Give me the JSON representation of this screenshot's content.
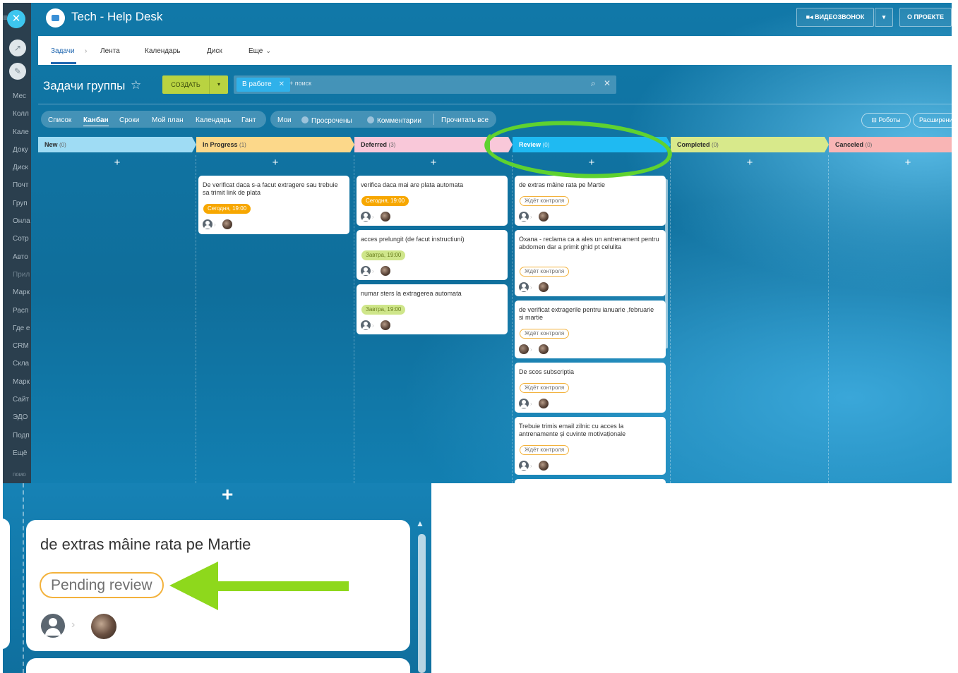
{
  "window": {
    "title": "Tech - Help Desk",
    "video_call": "ВИДЕОЗВОНОК",
    "about": "О ПРОЕКТЕ"
  },
  "leftbar": {
    "items": [
      "Мес",
      "Колл",
      "Кале",
      "Доку",
      "Диск",
      "Почт",
      "Груп",
      "Онла",
      "Сотр",
      "Авто",
      "Прил",
      "Марк",
      "Расп",
      "Где е",
      "CRM",
      "Скла",
      "Марк",
      "Сайт",
      "ЭДО",
      "Подп",
      "Ещё"
    ],
    "bottom": "помо"
  },
  "tabs": [
    "Задачи",
    "Лента",
    "Календарь",
    "Диск",
    "Еще"
  ],
  "page": {
    "title": "Задачи группы",
    "create": "СОЗДАТЬ",
    "filter_chip": "В работе",
    "search_placeholder": "+ поиск"
  },
  "views": {
    "list": "Список",
    "kanban": "Канбан",
    "deadlines": "Сроки",
    "myplan": "Мой план",
    "calendar": "Календарь",
    "gantt": "Гант",
    "mine": "Мои",
    "overdue": "Просрочены",
    "comments": "Комментарии",
    "readall": "Прочитать все",
    "robots": "Роботы",
    "extensions": "Расширени"
  },
  "columns": [
    {
      "name": "New",
      "count": "(0)",
      "color": "#9fdcf4"
    },
    {
      "name": "In Progress",
      "count": "(1)",
      "color": "#fcd88a"
    },
    {
      "name": "Deferred",
      "count": "(3)",
      "color": "#f9c8d9"
    },
    {
      "name": "Review",
      "count": "(0)",
      "color": "#1fbaf2"
    },
    {
      "name": "Completed",
      "count": "(0)",
      "color": "#d8e98b"
    },
    {
      "name": "Canceled",
      "count": "(0)",
      "color": "#f9b5b5"
    }
  ],
  "cards": {
    "inprogress": [
      {
        "title": "De verificat daca s-a facut extragere sau trebuie sa trimit link de plata",
        "badge": "Сегодня, 19:00"
      }
    ],
    "deferred": [
      {
        "title": "verifica daca mai are plata automata",
        "badge": "Сегодня, 19:00"
      },
      {
        "title": "acces prelungit (de facut instructiuni)",
        "badge": "Завтра, 19:00"
      },
      {
        "title": "numar sters la extragerea automata",
        "badge": "Завтра, 19:00"
      }
    ],
    "review": [
      {
        "title": "de extras mâine rata pe Martie",
        "badge": "Ждёт контроля"
      },
      {
        "title": "Oxana - reclama ca a ales un antrenament pentru abdomen dar a primit ghid pt celulita",
        "badge": "Ждёт контроля"
      },
      {
        "title": "de verificat extragerile pentru ianuarie ,februarie si martie",
        "badge": "Ждёт контроля"
      },
      {
        "title": "De scos subscriptia",
        "badge": "Ждёт контроля"
      },
      {
        "title": "Trebuie trimis email zilnic cu acces la antrenamente și cuvinte motivaționale",
        "badge": "Ждёт контроля"
      }
    ]
  },
  "zoom": {
    "title": "de extras mâine rata pe Martie",
    "badge": "Pending review"
  },
  "colors": {
    "annotation": "#5fd22f",
    "arrow": "#8ed81c"
  }
}
